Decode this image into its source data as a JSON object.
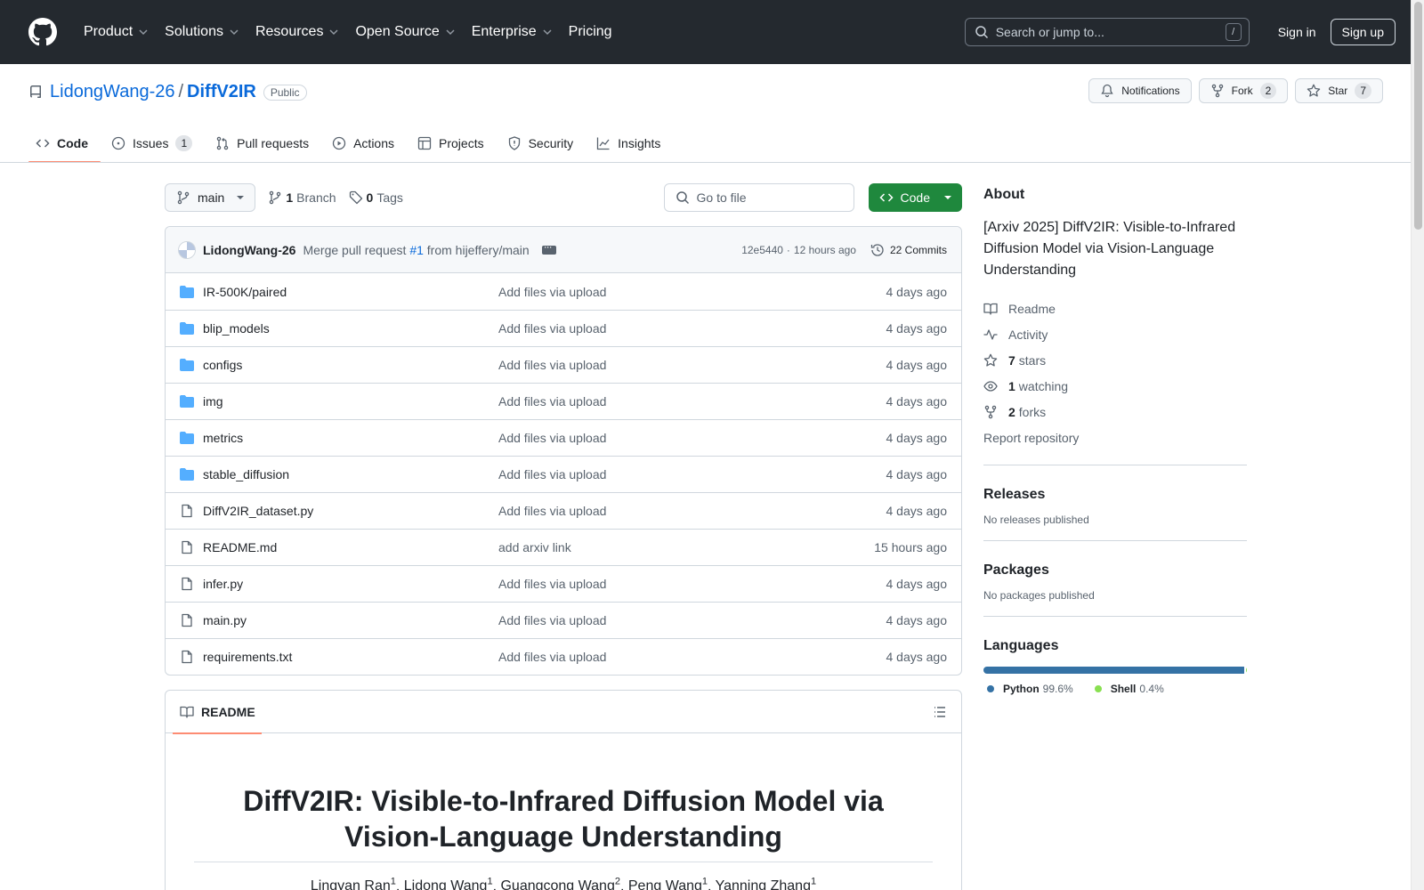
{
  "header": {
    "nav": [
      "Product",
      "Solutions",
      "Resources",
      "Open Source",
      "Enterprise",
      "Pricing"
    ],
    "search_placeholder": "Search or jump to...",
    "search_shortcut": "/",
    "sign_in": "Sign in",
    "sign_up": "Sign up"
  },
  "repo": {
    "owner": "LidongWang-26",
    "separator": "/",
    "name": "DiffV2IR",
    "visibility": "Public",
    "notifications": "Notifications",
    "fork_label": "Fork",
    "fork_count": "2",
    "star_label": "Star",
    "star_count": "7"
  },
  "tabs": [
    {
      "label": "Code",
      "icon": "code-icon"
    },
    {
      "label": "Issues",
      "count": "1",
      "icon": "issue-icon"
    },
    {
      "label": "Pull requests",
      "icon": "pull-request-icon"
    },
    {
      "label": "Actions",
      "icon": "play-icon"
    },
    {
      "label": "Projects",
      "icon": "table-icon"
    },
    {
      "label": "Security",
      "icon": "shield-icon"
    },
    {
      "label": "Insights",
      "icon": "graph-icon"
    }
  ],
  "file_nav": {
    "branch": "main",
    "branch_count": "1",
    "branch_label": "Branch",
    "tag_count": "0",
    "tag_label": "Tags",
    "go_to_file": "Go to file",
    "code_button": "Code"
  },
  "commit": {
    "author": "LidongWang-26",
    "message_prefix": "Merge pull request",
    "pr": "#1",
    "message_suffix": "from hijeffery/main",
    "hash": "12e5440",
    "dot": "·",
    "time": "12 hours ago",
    "commits_label": "22 Commits"
  },
  "files": [
    {
      "name": "IR-500K/paired",
      "type": "folder",
      "message": "Add files via upload",
      "date": "4 days ago"
    },
    {
      "name": "blip_models",
      "type": "folder",
      "message": "Add files via upload",
      "date": "4 days ago"
    },
    {
      "name": "configs",
      "type": "folder",
      "message": "Add files via upload",
      "date": "4 days ago"
    },
    {
      "name": "img",
      "type": "folder",
      "message": "Add files via upload",
      "date": "4 days ago"
    },
    {
      "name": "metrics",
      "type": "folder",
      "message": "Add files via upload",
      "date": "4 days ago"
    },
    {
      "name": "stable_diffusion",
      "type": "folder",
      "message": "Add files via upload",
      "date": "4 days ago"
    },
    {
      "name": "DiffV2IR_dataset.py",
      "type": "file",
      "message": "Add files via upload",
      "date": "4 days ago"
    },
    {
      "name": "README.md",
      "type": "file",
      "message": "add arxiv link",
      "date": "15 hours ago"
    },
    {
      "name": "infer.py",
      "type": "file",
      "message": "Add files via upload",
      "date": "4 days ago"
    },
    {
      "name": "main.py",
      "type": "file",
      "message": "Add files via upload",
      "date": "4 days ago"
    },
    {
      "name": "requirements.txt",
      "type": "file",
      "message": "Add files via upload",
      "date": "4 days ago"
    }
  ],
  "readme": {
    "tab": "README",
    "title": "DiffV2IR: Visible-to-Infrared Diffusion Model via Vision-Language Understanding",
    "authors": [
      {
        "name": "Lingyan Ran",
        "sup": "1"
      },
      {
        "name": "Lidong Wang",
        "sup": "1"
      },
      {
        "name": "Guangcong Wang",
        "sup": "2"
      },
      {
        "name": "Peng Wang",
        "sup": "1"
      },
      {
        "name": "Yanning Zhang",
        "sup": "1"
      }
    ]
  },
  "about": {
    "heading": "About",
    "description": "[Arxiv 2025] DiffV2IR: Visible-to-Infrared Diffusion Model via Vision-Language Understanding",
    "readme": "Readme",
    "activity": "Activity",
    "stars_count": "7",
    "stars_label": "stars",
    "watching_count": "1",
    "watching_label": "watching",
    "forks_count": "2",
    "forks_label": "forks",
    "report": "Report repository"
  },
  "releases": {
    "heading": "Releases",
    "text": "No releases published"
  },
  "packages": {
    "heading": "Packages",
    "text": "No packages published"
  },
  "languages": {
    "heading": "Languages",
    "items": [
      {
        "name": "Python",
        "percent": "99.6%",
        "value": 99.6,
        "color": "#3572A5"
      },
      {
        "name": "Shell",
        "percent": "0.4%",
        "value": 0.4,
        "color": "#89e051"
      }
    ]
  }
}
